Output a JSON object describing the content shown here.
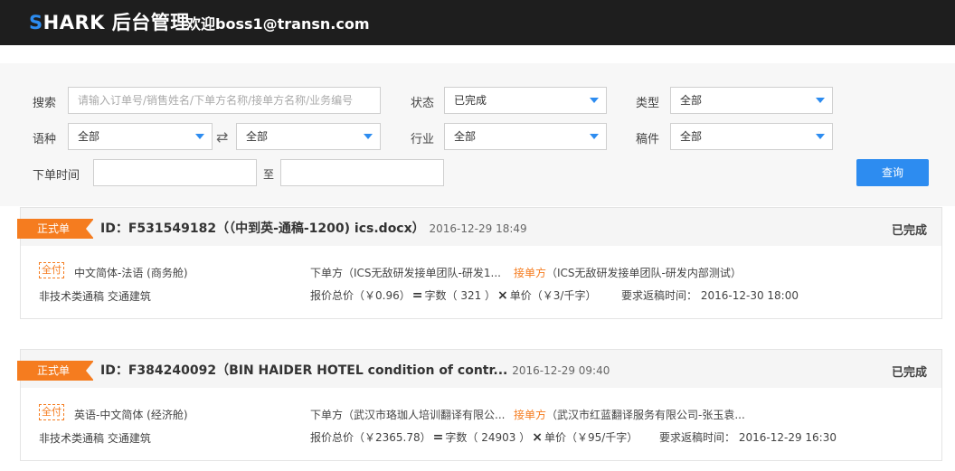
{
  "header": {
    "brand_s": "S",
    "brand_rest": "HARK 后台管理",
    "welcome": "欢迎boss1@transn.com"
  },
  "filters": {
    "search_label": "搜索",
    "search_placeholder": "请输入订单号/销售姓名/下单方名称/接单方名称/业务编号",
    "status_label": "状态",
    "status_value": "已完成",
    "type_label": "类型",
    "type_value": "全部",
    "lang_label": "语种",
    "lang_from": "全部",
    "lang_to": "全部",
    "industry_label": "行业",
    "industry_value": "全部",
    "doc_label": "稿件",
    "doc_value": "全部",
    "date_label": "下单时间",
    "date_to_label": "至",
    "date_from": "",
    "date_to": "",
    "query_button": "查询"
  },
  "orders": [
    {
      "ribbon": "正式单",
      "id_text": "ID：F531549182（（中到英-通稿-1200) ics.docx）",
      "time": "2016-12-29 18:49",
      "status": "已完成",
      "pay_tag": "全付",
      "language": "中文简体-法语 (商务舱)",
      "category": "非技术类通稿  交通建筑",
      "placer_label": "下单方",
      "placer": "（ICS无敌研发接单团队-研发1...",
      "receiver_label": "接单方",
      "receiver": "（ICS无敌研发接单团队-研发内部测试）",
      "total_label": "报价总价",
      "total": "（￥0.96）",
      "words_label": "字数",
      "words": "（ 321 ）",
      "unit_label": "单价",
      "unit": "（￥3/千字）",
      "deadline_label": "要求返稿时间：",
      "deadline": "2016-12-30 18:00"
    },
    {
      "ribbon": "正式单",
      "id_text": "ID：F384240092（BIN HAIDER HOTEL condition of contr...",
      "time": "2016-12-29 09:40",
      "status": "已完成",
      "pay_tag": "全付",
      "language": "英语-中文简体 (经济舱)",
      "category": "非技术类通稿  交通建筑",
      "placer_label": "下单方",
      "placer": "（武汉市珞珈人培训翻译有限公...",
      "receiver_label": "接单方",
      "receiver": "（武汉市红蓝翻译服务有限公司-张玉袁...",
      "total_label": "报价总价",
      "total": "（￥2365.78）",
      "words_label": "字数",
      "words": "（ 24903 ）",
      "unit_label": "单价",
      "unit": "（￥95/千字）",
      "deadline_label": "要求返稿时间：",
      "deadline": "2016-12-29 16:30"
    }
  ]
}
